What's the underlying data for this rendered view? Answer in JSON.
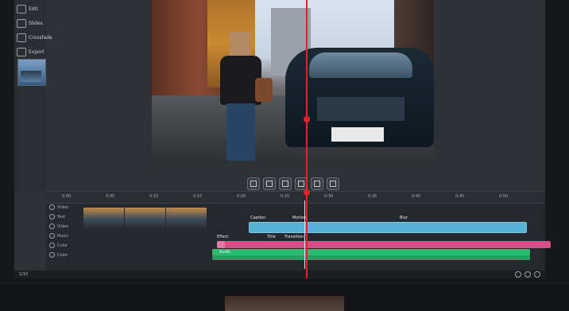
{
  "sidebar": {
    "items": [
      {
        "label": "Edit",
        "icon": "home-icon"
      },
      {
        "label": "Slides",
        "icon": "slides-icon"
      },
      {
        "label": "Crossfade",
        "icon": "crossfade-icon"
      },
      {
        "label": "Export",
        "icon": "export-icon"
      }
    ]
  },
  "preview_controls": [
    "play",
    "crop",
    "split",
    "trim",
    "export",
    "image"
  ],
  "timeline": {
    "ruler_ticks": [
      "0:00",
      "0:05",
      "0:10",
      "0:15",
      "0:20",
      "0:25",
      "0:30",
      "0:35",
      "0:40",
      "0:45",
      "0:50"
    ],
    "track_labels": [
      "Video",
      "Text",
      "Video",
      "Music",
      "Color",
      "Color"
    ],
    "clip_labels": [
      "Caption",
      "Motion",
      "Blur",
      "Effect",
      "Title",
      "Transition",
      "Audio"
    ]
  },
  "status": {
    "left": "1/10"
  },
  "colors": {
    "playhead": "#e2232a",
    "clip_blue": "#56b3d6",
    "clip_pink": "#d64f86",
    "clip_green": "#2fb870"
  }
}
